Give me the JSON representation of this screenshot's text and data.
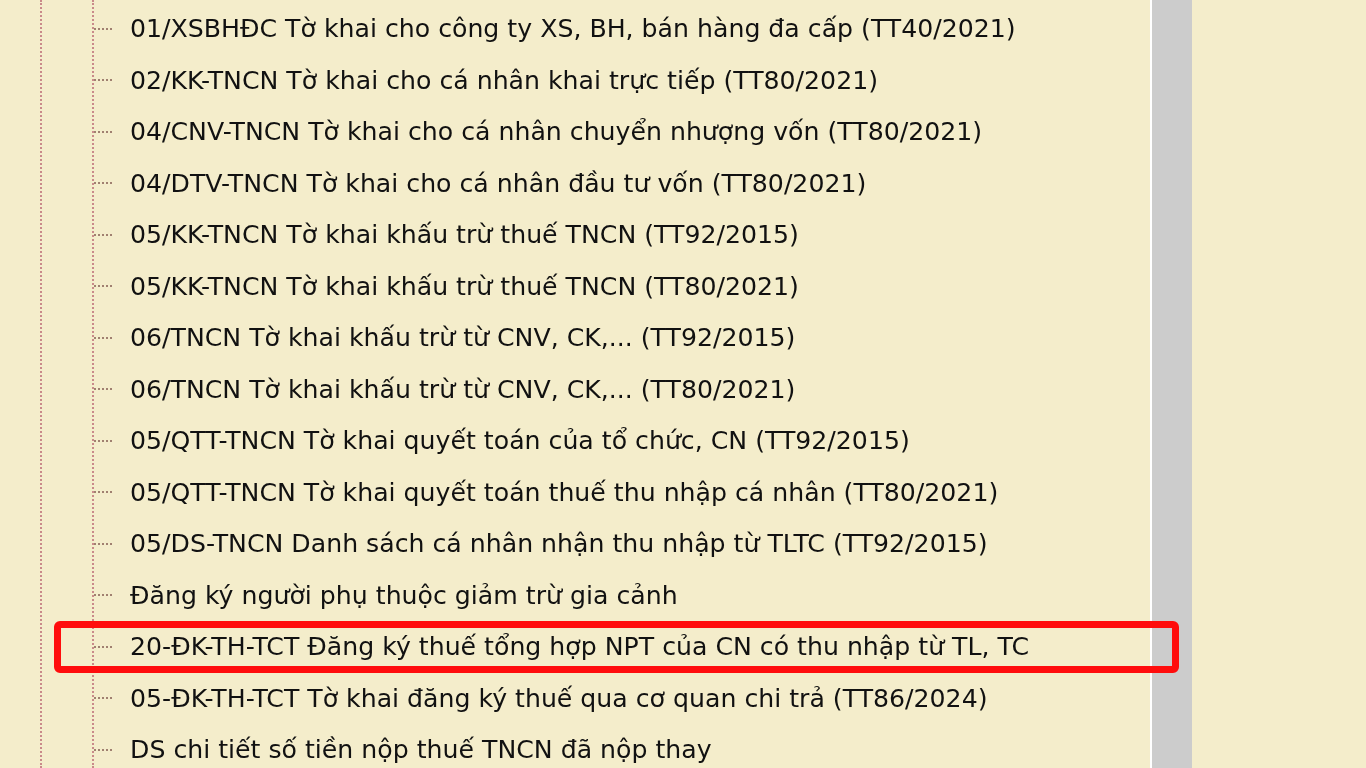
{
  "tree": {
    "items": [
      {
        "label": "01/XSBHĐC Tờ khai cho công ty XS, BH, bán hàng đa cấp (TT40/2021)",
        "highlighted": false
      },
      {
        "label": "02/KK-TNCN Tờ khai cho cá nhân khai trực tiếp (TT80/2021)",
        "highlighted": false
      },
      {
        "label": "04/CNV-TNCN Tờ khai cho cá nhân chuyển nhượng vốn (TT80/2021)",
        "highlighted": false
      },
      {
        "label": "04/DTV-TNCN Tờ khai cho cá nhân đầu tư vốn (TT80/2021)",
        "highlighted": false
      },
      {
        "label": "05/KK-TNCN Tờ khai khấu trừ thuế TNCN (TT92/2015)",
        "highlighted": false
      },
      {
        "label": "05/KK-TNCN Tờ khai khấu trừ thuế TNCN (TT80/2021)",
        "highlighted": false
      },
      {
        "label": "06/TNCN Tờ khai khấu trừ từ CNV, CK,... (TT92/2015)",
        "highlighted": false
      },
      {
        "label": "06/TNCN Tờ khai khấu trừ từ CNV, CK,... (TT80/2021)",
        "highlighted": false
      },
      {
        "label": "05/QTT-TNCN Tờ khai quyết toán của tổ chức, CN (TT92/2015)",
        "highlighted": false
      },
      {
        "label": "05/QTT-TNCN Tờ khai quyết toán thuế thu nhập cá nhân (TT80/2021)",
        "highlighted": false
      },
      {
        "label": "05/DS-TNCN Danh sách cá nhân nhận thu nhập từ TLTC (TT92/2015)",
        "highlighted": false
      },
      {
        "label": "Đăng ký người phụ thuộc giảm trừ gia cảnh",
        "highlighted": false
      },
      {
        "label": "20-ĐK-TH-TCT Đăng ký thuế tổng hợp NPT của CN có thu nhập từ TL, TC",
        "highlighted": true
      },
      {
        "label": "05-ĐK-TH-TCT Tờ khai đăng ký thuế qua cơ quan chi trả (TT86/2024)",
        "highlighted": false
      },
      {
        "label": "DS chi tiết số tiền nộp thuế TNCN đã nộp thay",
        "highlighted": false
      }
    ]
  }
}
